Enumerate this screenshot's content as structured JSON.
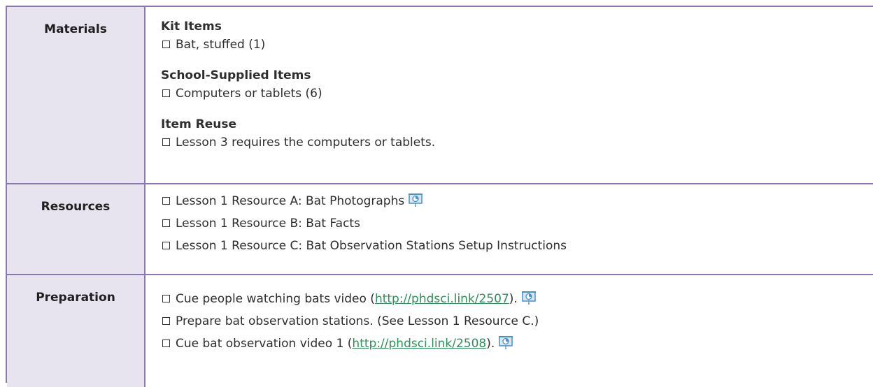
{
  "materials": {
    "label": "Materials",
    "kit_heading": "Kit Items",
    "kit_item": "Bat, stuffed (1)",
    "school_heading": "School-Supplied Items",
    "school_item": "Computers or tablets (6)",
    "reuse_heading": "Item Reuse",
    "reuse_item": "Lesson 3 requires the computers or tablets."
  },
  "resources": {
    "label": "Resources",
    "items": [
      "Lesson 1 Resource A: Bat Photographs",
      "Lesson 1 Resource B: Bat Facts",
      "Lesson 1 Resource C: Bat Observation Stations Setup Instructions"
    ]
  },
  "preparation": {
    "label": "Preparation",
    "item1_pre": "Cue people watching bats video (",
    "item1_link": "http://phdsci.link/2507",
    "item1_post": ").",
    "item2": "Prepare bat observation stations. (See Lesson 1 Resource C.)",
    "item3_pre": "Cue bat observation video 1 (",
    "item3_link": "http://phdsci.link/2508",
    "item3_post": ")."
  },
  "colors": {
    "border": "#8b78ad",
    "label_bg": "#e7e3ef",
    "link": "#2f8f5a",
    "icon": "#4a90c8"
  },
  "icons": {
    "presentation": "presentation-screen-icon"
  }
}
